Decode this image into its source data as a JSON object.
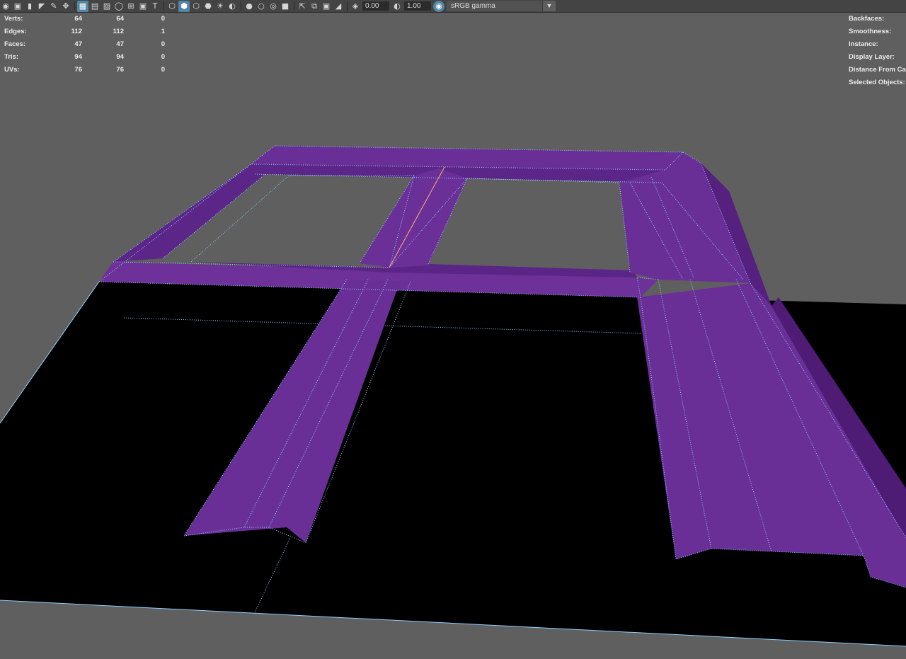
{
  "toolbar": {
    "icons": [
      "camera-icon",
      "camera-attributes-icon",
      "bookmark-icon",
      "image-plane-icon",
      "grease-pencil-icon",
      "2d-pan-zoom-icon",
      "grid-icon",
      "film-gate-icon",
      "resolution-gate-icon",
      "gate-mask-icon",
      "field-chart-icon",
      "safe-action-icon",
      "safe-title-icon",
      "wireframe-icon",
      "smooth-shade-icon",
      "default-material-icon",
      "textured-icon",
      "use-all-lights-icon",
      "shadows-icon",
      "screen-space-ao-icon",
      "motion-blur-icon",
      "multisample-aa-icon",
      "depth-of-field-icon",
      "isolate-select-icon",
      "xray-icon",
      "xray-joints-icon",
      "xray-active-icon",
      "exposure-icon",
      "gamma-icon",
      "color-management-icon"
    ],
    "exposure": "0.00",
    "gamma": "1.00",
    "colorspace": "sRGB gamma"
  },
  "hud_left": {
    "rows": [
      {
        "label": "Verts:",
        "c1": "64",
        "c2": "64",
        "c3": "0"
      },
      {
        "label": "Edges:",
        "c1": "112",
        "c2": "112",
        "c3": "1"
      },
      {
        "label": "Faces:",
        "c1": "47",
        "c2": "47",
        "c3": "0"
      },
      {
        "label": "Tris:",
        "c1": "94",
        "c2": "94",
        "c3": "0"
      },
      {
        "label": "UVs:",
        "c1": "76",
        "c2": "76",
        "c3": "0"
      }
    ]
  },
  "hud_right": {
    "labels": [
      "Backfaces:",
      "Smoothness:",
      "Instance:",
      "Display Layer:",
      "Distance From Camera:",
      "Selected Objects:"
    ]
  },
  "colors": {
    "viewport_bg": "#5f5f5f",
    "plane": "#000000",
    "mesh": "#6a2f96",
    "mesh_dark": "#521f7c",
    "wire": "#8fd0ff",
    "selected_edge": "#ffb070"
  }
}
